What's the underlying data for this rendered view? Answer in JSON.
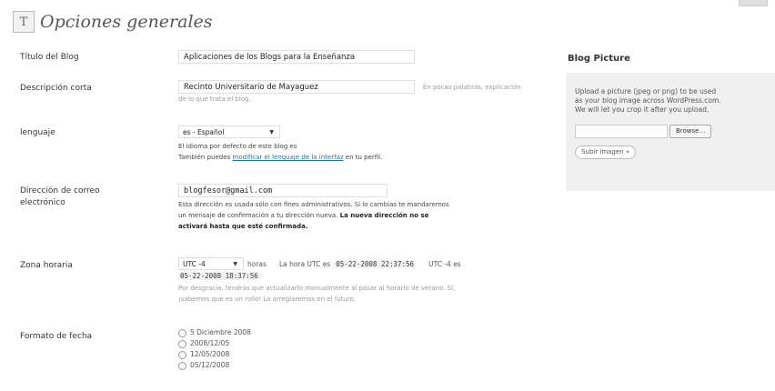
{
  "header": {
    "title": "Opciones generales"
  },
  "blog_title": {
    "label": "Título del Blog",
    "value": "Aplicaciones de los Blogs para la Enseñanza"
  },
  "short_desc": {
    "label": "Descripción corta",
    "value": "Recinto Universitario de Mayaguez",
    "hint_inline": "En pocas palabras, explicación",
    "hint_line2": "de lo que trata el blog."
  },
  "language": {
    "label": "lenguaje",
    "selected": "es - Español",
    "desc1": "El idioma por defecto de este blog es",
    "desc2_prefix": "También puedes",
    "desc2_link": "modificar el lenguaje de la interfaz",
    "desc2_suffix": "en tu perfil."
  },
  "email": {
    "label_line1": "Dirección de correo",
    "label_line2": "electrónico",
    "value": "blogfesor@gmail.com",
    "desc1": "Esta dirección es usada sólo con fines administrativos. Si lo cambias te mandaremos",
    "desc2_prefix": "un mensaje de confirmación a tu dirección nueva.",
    "desc2_bold": "La nueva dirección no se",
    "desc3_bold": "activará hasta que esté confirmada."
  },
  "timezone": {
    "label": "Zona horaria",
    "selected": "UTC -4",
    "hours_label": "horas",
    "utc_text": "La hora UTC es",
    "utc_time": "05-22-2008 22:37:56",
    "local_text": "UTC -4 es",
    "local_time": "05-22-2008 18:37:56",
    "desc1": "Por desgracia, tendrás que actualizarlo manualmente al pasar al horario de verano. Sí,",
    "desc2": "¡sabemos que es un rollo! Lo arreglaremos en el futuro."
  },
  "date_format": {
    "label": "Formato de fecha",
    "options": [
      "5 Diciembre 2008",
      "2008/12/05",
      "12/05/2008",
      "05/12/2008"
    ]
  },
  "blog_picture": {
    "title": "Blog Picture",
    "text_line1": "Upload a picture (jpeg or png) to be used",
    "text_line2": "as your blog image across WordPress.com.",
    "text_line3": "We will let you crop it after you upload.",
    "browse_label": "Browse...",
    "upload_label": "Subir imagen »"
  }
}
